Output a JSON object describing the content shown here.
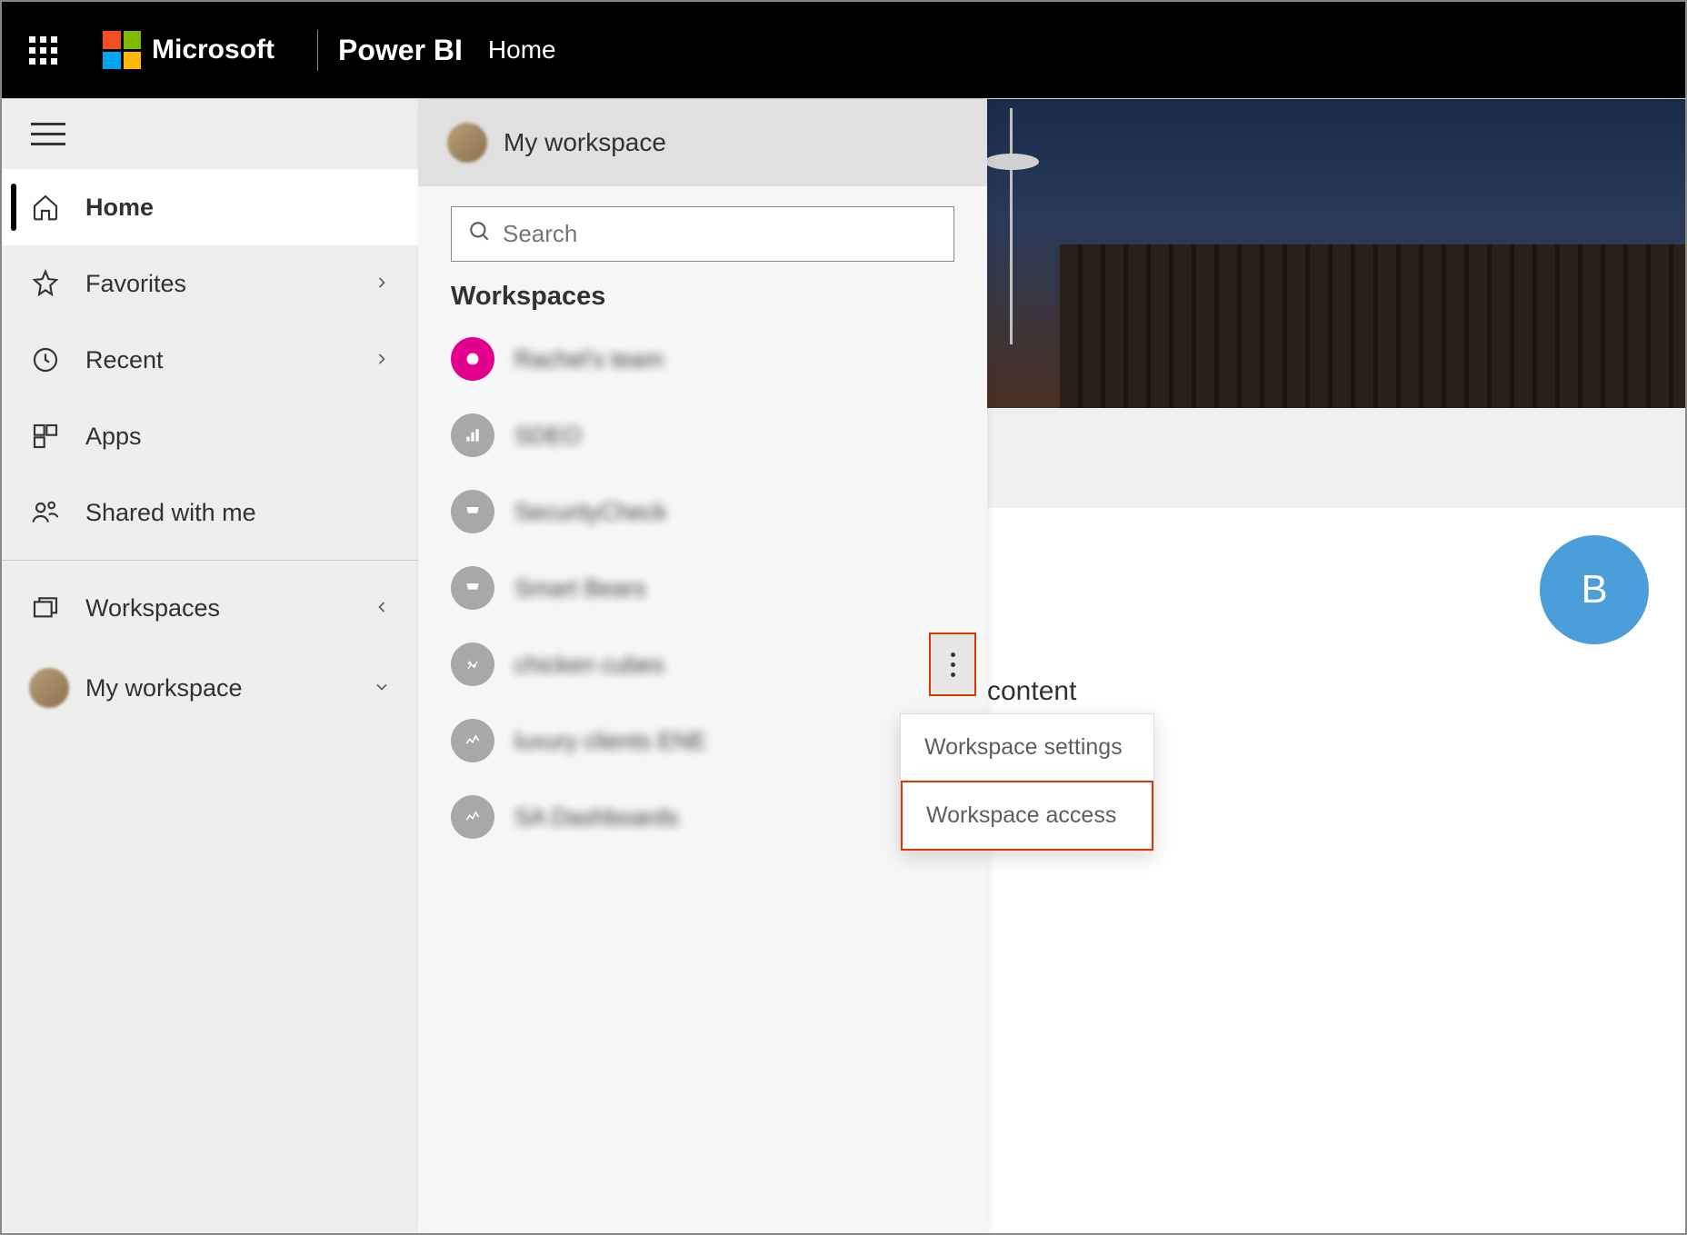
{
  "header": {
    "company": "Microsoft",
    "product": "Power BI",
    "page": "Home"
  },
  "sidebar": {
    "items": [
      {
        "label": "Home",
        "icon": "home",
        "active": true
      },
      {
        "label": "Favorites",
        "icon": "star",
        "expand": true
      },
      {
        "label": "Recent",
        "icon": "clock",
        "expand": true
      },
      {
        "label": "Apps",
        "icon": "apps"
      },
      {
        "label": "Shared with me",
        "icon": "shared"
      }
    ],
    "bottom": {
      "workspaces_label": "Workspaces",
      "my_workspace_label": "My workspace"
    }
  },
  "flyout": {
    "header_label": "My workspace",
    "search": {
      "placeholder": "Search"
    },
    "section_heading": "Workspaces",
    "workspaces": [
      {
        "label": "Rachel's team",
        "icon_color": "pink"
      },
      {
        "label": "SDEO",
        "icon_color": "gray"
      },
      {
        "label": "SecurityCheck",
        "icon_color": "gray"
      },
      {
        "label": "Smart Bears",
        "icon_color": "gray"
      },
      {
        "label": "chicken cubes",
        "icon_color": "gray",
        "show_more": true
      },
      {
        "label": "luxury clients ENE",
        "icon_color": "gray"
      },
      {
        "label": "SA Dashboards",
        "icon_color": "gray"
      }
    ]
  },
  "context_menu": {
    "settings_label": "Workspace settings",
    "access_label": "Workspace access"
  },
  "background": {
    "circle_letter": "B",
    "content_label": "content"
  }
}
